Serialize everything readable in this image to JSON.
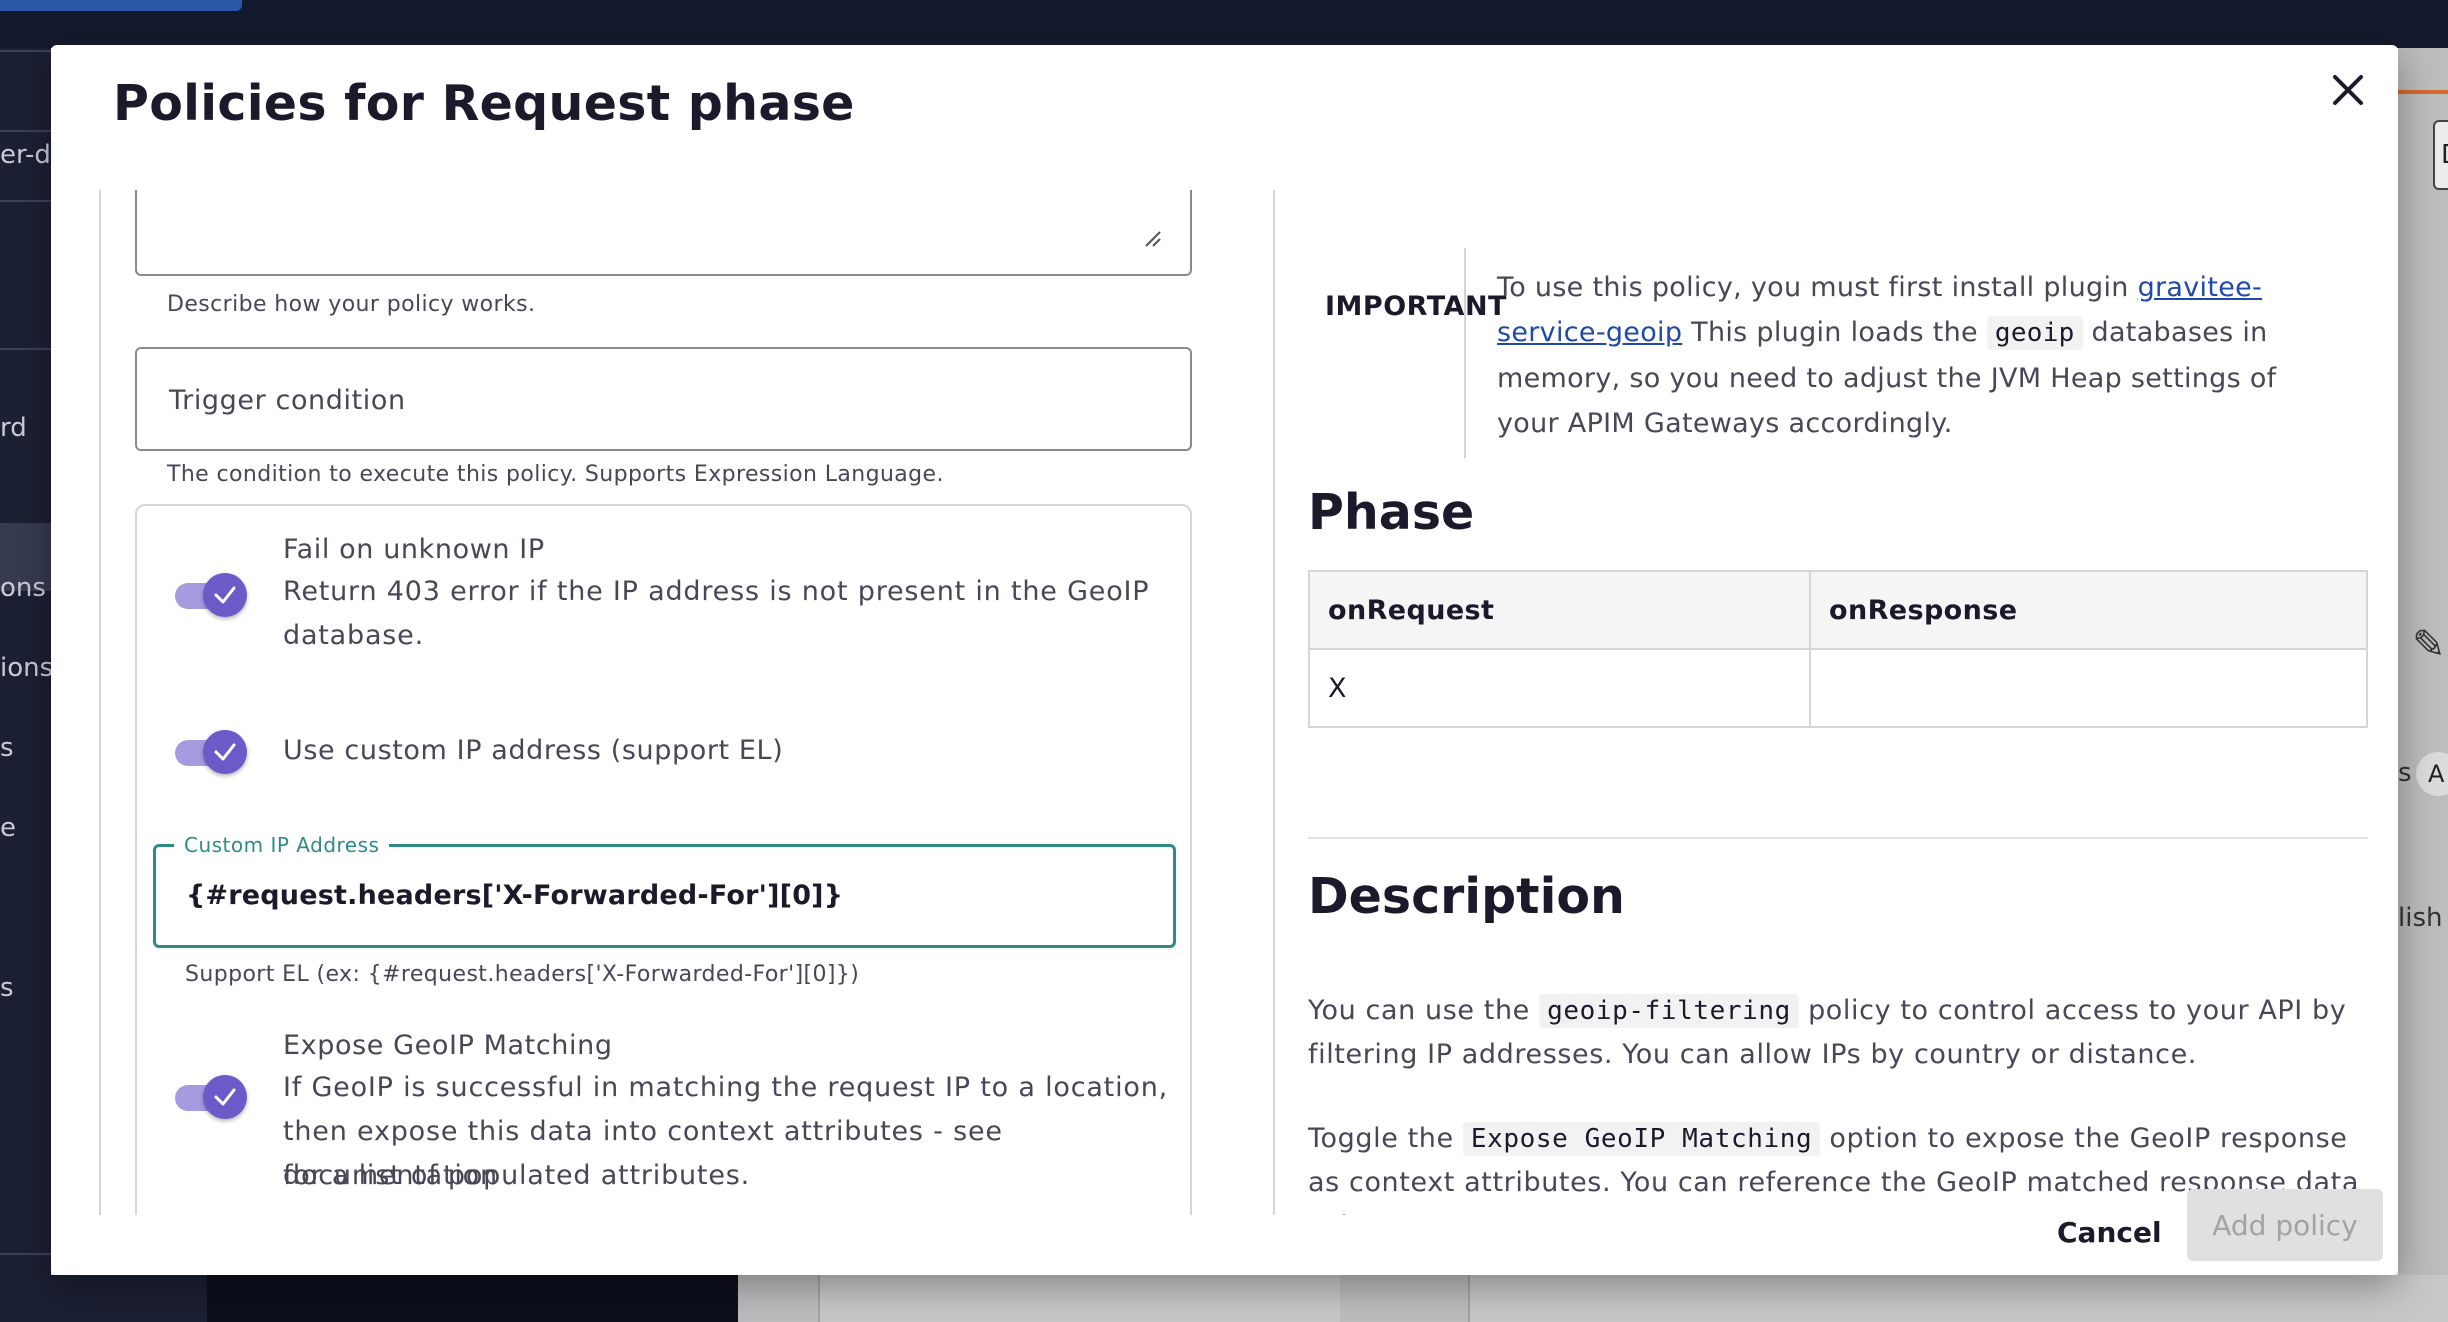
{
  "modal": {
    "title": "Policies for Request phase",
    "close_icon": "close-icon"
  },
  "background": {
    "sidebar_labels": [
      "er-d",
      "rd",
      "ons",
      "ions",
      "s",
      "e",
      "s"
    ],
    "right_labels": {
      "chip": "D",
      "text1": "s",
      "avatar": "A",
      "text2": "lish"
    }
  },
  "form": {
    "description_hint": "Describe how your policy works.",
    "trigger_label": "Trigger condition",
    "trigger_hint": "The condition to execute this policy. Supports Expression Language.",
    "fail_unknown_ip": {
      "title": "Fail on unknown IP",
      "desc_line1": "Return 403 error if the IP address is not present in the GeoIP",
      "desc_line2": "database.",
      "enabled": true
    },
    "custom_ip_toggle": {
      "title": "Use custom IP address (support EL)",
      "enabled": true
    },
    "custom_ip": {
      "label": "Custom IP Address",
      "value": "{#request.headers['X-Forwarded-For'][0]}",
      "hint": "Support EL (ex: {#request.headers['X-Forwarded-For'][0]})"
    },
    "expose_geoip": {
      "title": "Expose GeoIP Matching",
      "desc_line1": "If GeoIP is successful in matching the request IP to a location,",
      "desc_line2": "then expose this data into context attributes - see documentation",
      "desc_line3": "for a list of populated attributes.",
      "enabled": true
    }
  },
  "docs": {
    "important_label": "IMPORTANT",
    "important_text_1": "To use this policy, you must first install plugin ",
    "important_link": "gravitee-service-geoip",
    "important_text_2": " This plugin loads the ",
    "important_code": "geoip",
    "important_text_3": " databases in memory, so you need to adjust the JVM Heap settings of your APIM Gateways accordingly.",
    "phase_heading": "Phase",
    "phase_table": {
      "headers": [
        "onRequest",
        "onResponse"
      ],
      "row": [
        "X",
        ""
      ]
    },
    "description_heading": "Description",
    "desc_p1_a": "You can use the ",
    "desc_p1_code": "geoip-filtering",
    "desc_p1_b": " policy to control access to your API by filtering IP addresses. You can allow IPs by country or distance.",
    "desc_p2_a": "Toggle the ",
    "desc_p2_code": "Expose GeoIP Matching",
    "desc_p2_b": " option to expose the GeoIP response as context attributes. You can reference the GeoIP matched response data using"
  },
  "footer": {
    "cancel_label": "Cancel",
    "add_label": "Add policy"
  },
  "colors": {
    "accent": "#6b5bc9",
    "focus": "#2e8b86",
    "link": "#1f4aa8"
  }
}
